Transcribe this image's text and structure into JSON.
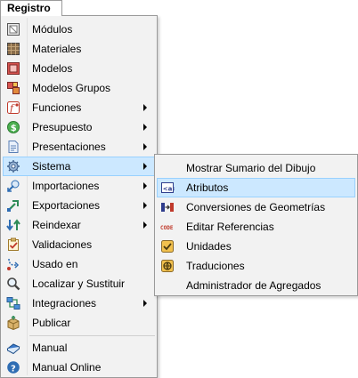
{
  "menubar": {
    "title": "Registro"
  },
  "main_menu": {
    "items": [
      {
        "label": "Módulos",
        "icon": "modules-icon",
        "submenu": false
      },
      {
        "label": "Materiales",
        "icon": "materials-icon",
        "submenu": false
      },
      {
        "label": "Modelos",
        "icon": "models-icon",
        "submenu": false
      },
      {
        "label": "Modelos Grupos",
        "icon": "model-groups-icon",
        "submenu": false
      },
      {
        "label": "Funciones",
        "icon": "functions-icon",
        "submenu": true
      },
      {
        "label": "Presupuesto",
        "icon": "budget-icon",
        "submenu": true
      },
      {
        "label": "Presentaciones",
        "icon": "presentations-icon",
        "submenu": true
      },
      {
        "label": "Sistema",
        "icon": "system-icon",
        "submenu": true,
        "highlighted": true
      },
      {
        "label": "Importaciones",
        "icon": "imports-icon",
        "submenu": true
      },
      {
        "label": "Exportaciones",
        "icon": "exports-icon",
        "submenu": true
      },
      {
        "label": "Reindexar",
        "icon": "reindex-icon",
        "submenu": true
      },
      {
        "label": "Validaciones",
        "icon": "validations-icon",
        "submenu": false
      },
      {
        "label": "Usado en",
        "icon": "used-in-icon",
        "submenu": false
      },
      {
        "label": "Localizar y Sustituir",
        "icon": "find-replace-icon",
        "submenu": false
      },
      {
        "label": "Integraciones",
        "icon": "integrations-icon",
        "submenu": true
      },
      {
        "label": "Publicar",
        "icon": "publish-icon",
        "submenu": false
      },
      {
        "label": "Manual",
        "icon": "manual-icon",
        "submenu": false
      },
      {
        "label": "Manual Online",
        "icon": "help-icon",
        "submenu": false
      }
    ]
  },
  "sub_menu": {
    "items": [
      {
        "label": "Mostrar Sumario del Dibujo",
        "icon": ""
      },
      {
        "label": "Atributos",
        "icon": "attributes-icon",
        "highlighted": true
      },
      {
        "label": "Conversiones de Geometrías",
        "icon": "geometry-conversion-icon"
      },
      {
        "label": "Editar Referencias",
        "icon": "code-icon"
      },
      {
        "label": "Unidades",
        "icon": "units-icon"
      },
      {
        "label": "Traduciones",
        "icon": "translations-icon"
      },
      {
        "label": "Administrador de Agregados",
        "icon": ""
      }
    ]
  },
  "colors": {
    "highlight_bg": "#cce8ff",
    "highlight_border": "#99d1ff",
    "menu_bg": "#f2f2f2"
  }
}
